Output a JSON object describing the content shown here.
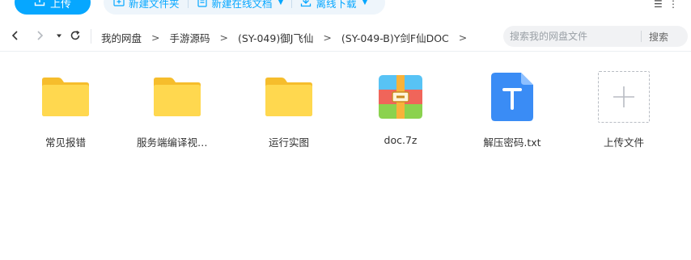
{
  "toolbar": {
    "upload_label": "上传",
    "new_folder_label": "新建文件夹",
    "new_online_doc_label": "新建在线文档",
    "offline_download_label": "离线下载"
  },
  "breadcrumb": {
    "items": [
      "我的网盘",
      "手游源码",
      "(SY-049)御J飞仙",
      "(SY-049-B)Y剑F仙DOC"
    ],
    "separator": ">"
  },
  "search": {
    "placeholder": "搜索我的网盘文件",
    "button_label": "搜索"
  },
  "files": [
    {
      "name": "常见报错",
      "icon": "folder-icon"
    },
    {
      "name": "服务端编译视频教程",
      "icon": "folder-icon"
    },
    {
      "name": "运行实图",
      "icon": "folder-icon"
    },
    {
      "name": "doc.7z",
      "icon": "archive-icon"
    },
    {
      "name": "解压密码.txt",
      "icon": "text-file-icon"
    }
  ],
  "upload_tile": {
    "label": "上传文件",
    "icon": "plus-icon"
  },
  "colors": {
    "accent": "#06a7ff",
    "folder": "#ffd24a",
    "text_file": "#3a8cf5"
  }
}
